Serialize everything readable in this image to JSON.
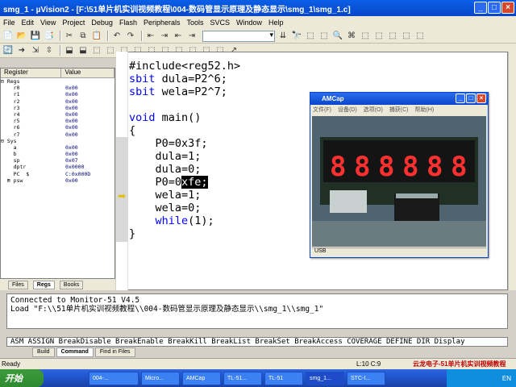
{
  "window": {
    "title": "smg_1  - µVision2 - [F:\\51单片机实训视频教程\\004-数码管显示原理及静态显示\\smg_1\\smg_1.c]",
    "min": "_",
    "max": "□",
    "close": "×"
  },
  "menu": [
    "File",
    "Edit",
    "View",
    "Project",
    "Debug",
    "Flash",
    "Peripherals",
    "Tools",
    "SVCS",
    "Window",
    "Help"
  ],
  "toolbar": {
    "row1": [
      "📄",
      "📂",
      "💾",
      "📑",
      "✂",
      "⧉",
      "📋",
      "↶",
      "↷",
      "⇤",
      "⇥",
      "⇤",
      "⇥"
    ],
    "row1b": [
      "⇊",
      "🔭",
      "⬚",
      "⬚",
      "🔍",
      "⌘",
      "⬚",
      "⬚",
      "⬚",
      "⬚",
      "⬚"
    ],
    "row2": [
      "🔄",
      "➜",
      "⇲",
      "⇳",
      "⬓",
      "⬓",
      "⬚",
      "⬚",
      "⬚",
      "⬚",
      "⬚",
      "⬚",
      "⬚",
      "⬚",
      "⬚",
      "⬚",
      "↗"
    ]
  },
  "regpanel": {
    "col_register": "Register",
    "col_value": "Value",
    "rows": [
      {
        "name": "⊟ Regs",
        "value": ""
      },
      {
        "name": "    r0",
        "value": "0x00"
      },
      {
        "name": "    r1",
        "value": "0x00"
      },
      {
        "name": "    r2",
        "value": "0x00"
      },
      {
        "name": "    r3",
        "value": "0x00"
      },
      {
        "name": "    r4",
        "value": "0x00"
      },
      {
        "name": "    r5",
        "value": "0x00"
      },
      {
        "name": "    r6",
        "value": "0x00"
      },
      {
        "name": "    r7",
        "value": "0x00"
      },
      {
        "name": "⊟ Sys",
        "value": ""
      },
      {
        "name": "    a",
        "value": "0x00"
      },
      {
        "name": "    b",
        "value": "0x00"
      },
      {
        "name": "    sp",
        "value": "0x07"
      },
      {
        "name": "    dptr",
        "value": "0x0000"
      },
      {
        "name": "    PC  $",
        "value": "C:0x000D"
      },
      {
        "name": "  ⊞ psw",
        "value": "0x00"
      }
    ],
    "tabs": [
      "Files",
      "Regs",
      "Books"
    ]
  },
  "code": {
    "l1": "#include<reg52.h>",
    "l2_kw": "sbit",
    "l2": " dula=P2^6;",
    "l3_kw": "sbit",
    "l3": " wela=P2^7;",
    "l5_kw": "void",
    "l5": " main()",
    "l6": "{",
    "l7": "    P0=0x3f;",
    "l8": "    dula=1;",
    "l9": "    dula=0;",
    "l10a": "    P0=0",
    "l10b": "xfe;",
    "l11": "    wela=1;",
    "l12": "    wela=0;",
    "l13a": "    ",
    "l13_kw": "while",
    "l13b": "(1);",
    "l14": "}",
    "arrow": "➡"
  },
  "amcap": {
    "title": "AMCap",
    "min": "_",
    "max": "□",
    "close": "×",
    "menu": [
      "文件(F)",
      "设备(D)",
      "选项(O)",
      "捕获(C)",
      "帮助(H)"
    ],
    "digits": [
      "8",
      "8",
      "8",
      "8",
      "8",
      "8"
    ],
    "status": "USB"
  },
  "output": {
    "line1": "Connected to Monitor-51 V4.5",
    "line2": "Load \"F:\\\\51单片机实训视频教程\\\\004-数码管显示原理及静态显示\\\\smg_1\\\\smg_1\""
  },
  "cmdline": "ASM ASSIGN BreakDisable BreakEnable BreakKill BreakList BreakSet BreakAccess COVERAGE DEFINE DIR Display",
  "outtabs": [
    "Build",
    "Command",
    "Find in Files"
  ],
  "status": {
    "ready": "Ready",
    "pos": "L:10 C:9",
    "brand": "云龙电子-51单片机实训视频教程"
  },
  "taskbar": {
    "start": "开始",
    "tasks": [
      "004-...",
      "Micro...",
      "AMCap",
      "TL-51...",
      "TL-51",
      "smg_1...",
      "STC-I..."
    ],
    "tray": "EN"
  }
}
